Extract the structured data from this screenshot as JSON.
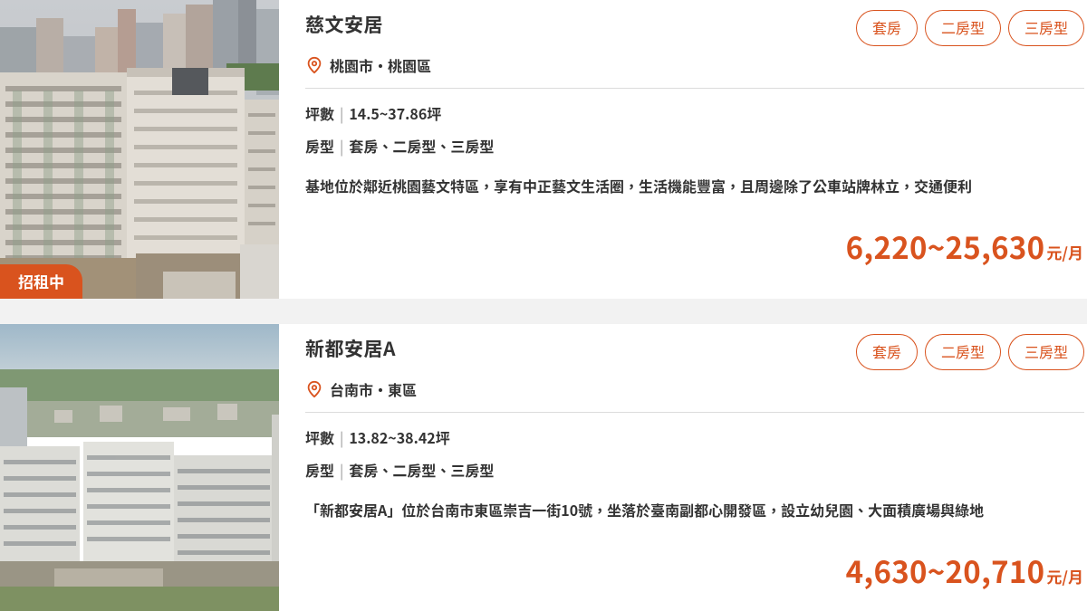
{
  "listings": [
    {
      "title": "慈文安居",
      "status_badge": "招租中",
      "tags": [
        "套房",
        "二房型",
        "三房型"
      ],
      "location": "桃園市・桃園區",
      "area_label": "坪數",
      "area_value": "14.5~37.86坪",
      "type_label": "房型",
      "type_value": "套房、二房型、三房型",
      "description": "基地位於鄰近桃園藝文特區，享有中正藝文生活圈，生活機能豐富，且周邊除了公車站牌林立，交通便利",
      "price": "6,220~25,630",
      "price_unit": "元/月"
    },
    {
      "title": "新都安居A",
      "tags": [
        "套房",
        "二房型",
        "三房型"
      ],
      "location": "台南市・東區",
      "area_label": "坪數",
      "area_value": "13.82~38.42坪",
      "type_label": "房型",
      "type_value": "套房、二房型、三房型",
      "description": "「新都安居A」位於台南市東區崇吉一街10號，坐落於臺南副都心開發區，設立幼兒園、大面積廣場與綠地",
      "price": "4,630~20,710",
      "price_unit": "元/月"
    }
  ],
  "colors": {
    "accent": "#d9531e",
    "text": "#333333",
    "background": "#f2f2f2"
  },
  "icons": {
    "location": "location-pin-icon"
  }
}
